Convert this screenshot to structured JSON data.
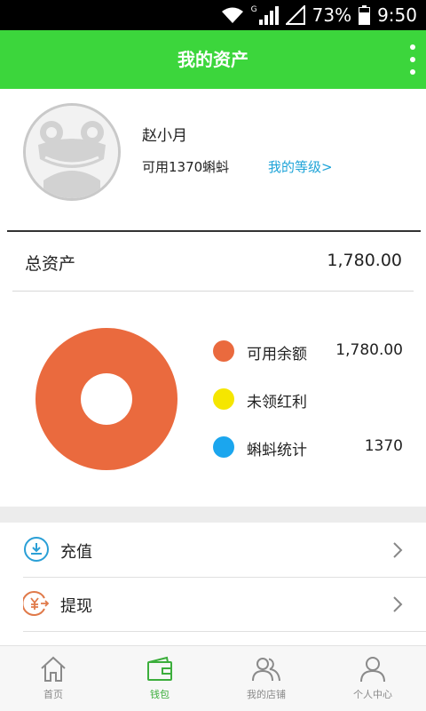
{
  "status_bar": {
    "network_type": "G",
    "battery": "73%",
    "time": "9:50",
    "icons": [
      "wifi-icon",
      "signal-icon",
      "empty-signal-icon",
      "battery-icon"
    ]
  },
  "app_bar": {
    "title": "我的资产",
    "menu_icon": "more-vert-icon",
    "color": "#3cd63c"
  },
  "profile": {
    "name": "赵小月",
    "available_points": "可用1370蝌蚪",
    "level_link": "我的等级>",
    "avatar_icon": "frog-avatar-icon"
  },
  "total_assets": {
    "label": "总资产",
    "value": "1,780.00"
  },
  "chart_data": {
    "type": "pie",
    "categories": [
      "可用余额",
      "未领红利",
      "蝌蚪统计"
    ],
    "values": [
      1780.0,
      0,
      1370
    ],
    "value_labels": [
      "1,780.00",
      "",
      "1370"
    ],
    "colors": [
      "#ea6a3e",
      "#f5e600",
      "#1ba6ee"
    ],
    "style": "donut",
    "legend_position": "right"
  },
  "menu": {
    "items": [
      {
        "label": "充值",
        "icon": "download-circle-icon",
        "color": "#2a9fd6"
      },
      {
        "label": "提现",
        "icon": "yuan-transfer-icon",
        "color": "#e07a4a"
      }
    ]
  },
  "bottom_nav": {
    "tabs": [
      {
        "label": "首页",
        "icon": "home-icon",
        "active": false
      },
      {
        "label": "钱包",
        "icon": "wallet-icon",
        "active": true
      },
      {
        "label": "我的店铺",
        "icon": "people-icon",
        "active": false
      },
      {
        "label": "个人中心",
        "icon": "person-icon",
        "active": false
      }
    ],
    "active_color": "#3cae3c"
  }
}
